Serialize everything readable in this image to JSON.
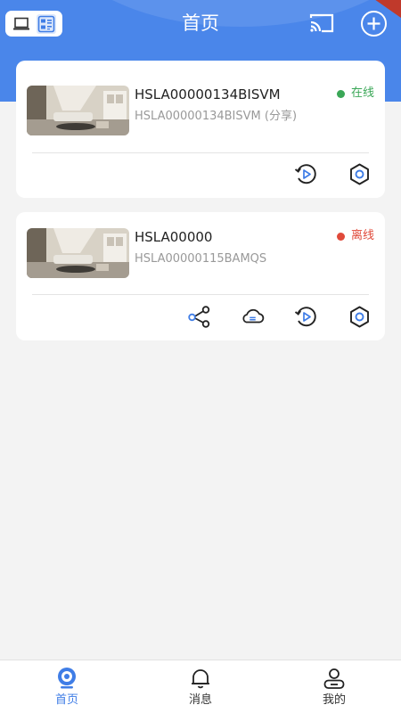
{
  "header": {
    "title": "首页",
    "view_modes": [
      {
        "name": "laptop-icon",
        "active": false
      },
      {
        "name": "list-grid-icon",
        "active": true
      }
    ],
    "cast_icon": "cast-icon",
    "add_icon": "plus-circle-icon",
    "colors": {
      "primary": "#4a86ea",
      "ribbon": "#c0392b"
    }
  },
  "devices": [
    {
      "name": "HSLA00000134BISVM",
      "subtitle": "HSLA00000134BISVM (分享)",
      "status": "在线",
      "status_color": "#3aa757",
      "actions": [
        "playback-icon",
        "settings-gear-icon"
      ]
    },
    {
      "name": "HSLA00000",
      "subtitle": "HSLA00000115BAMQS",
      "status": "离线",
      "status_color": "#e04a3a",
      "actions": [
        "share-icon",
        "cloud-icon",
        "playback-icon",
        "settings-gear-icon"
      ]
    }
  ],
  "tabbar": {
    "items": [
      {
        "label": "首页",
        "icon": "camera-home-icon",
        "active": true
      },
      {
        "label": "消息",
        "icon": "bell-icon",
        "active": false
      },
      {
        "label": "我的",
        "icon": "user-icon",
        "active": false
      }
    ],
    "active_color": "#3f7de6"
  }
}
